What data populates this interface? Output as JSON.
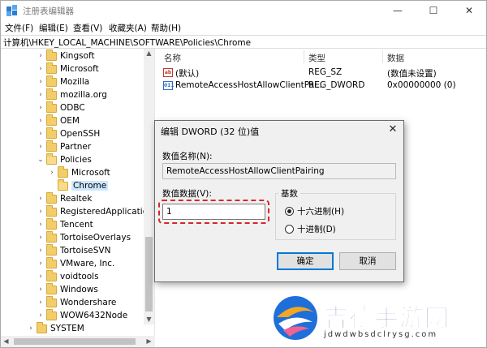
{
  "window": {
    "title": "注册表编辑器",
    "minimize": "—",
    "maximize": "☐",
    "close": "✕"
  },
  "menu": [
    "文件(F)",
    "编辑(E)",
    "查看(V)",
    "收藏夹(A)",
    "帮助(H)"
  ],
  "address": "计算机\\HKEY_LOCAL_MACHINE\\SOFTWARE\\Policies\\Chrome",
  "tree": [
    {
      "label": "Kingsoft",
      "chevron": "›"
    },
    {
      "label": "Microsoft",
      "chevron": "›"
    },
    {
      "label": "Mozilla",
      "chevron": "›"
    },
    {
      "label": "mozilla.org",
      "chevron": "›"
    },
    {
      "label": "ODBC",
      "chevron": "›"
    },
    {
      "label": "OEM",
      "chevron": "›"
    },
    {
      "label": "OpenSSH",
      "chevron": "›"
    },
    {
      "label": "Partner",
      "chevron": "›"
    },
    {
      "label": "Policies",
      "chevron": "⌄"
    },
    {
      "label": "Microsoft",
      "chevron": "›"
    },
    {
      "label": "Chrome",
      "chevron": ""
    },
    {
      "label": "Realtek",
      "chevron": "›"
    },
    {
      "label": "RegisteredApplication",
      "chevron": "›"
    },
    {
      "label": "Tencent",
      "chevron": "›"
    },
    {
      "label": "TortoiseOverlays",
      "chevron": "›"
    },
    {
      "label": "TortoiseSVN",
      "chevron": "›"
    },
    {
      "label": "VMware, Inc.",
      "chevron": "›"
    },
    {
      "label": "voidtools",
      "chevron": "›"
    },
    {
      "label": "Windows",
      "chevron": "›"
    },
    {
      "label": "Wondershare",
      "chevron": "›"
    },
    {
      "label": "WOW6432Node",
      "chevron": "›"
    },
    {
      "label": "SYSTEM",
      "chevron": "›"
    }
  ],
  "list": {
    "headers": {
      "name": "名称",
      "type": "类型",
      "data": "数据"
    },
    "rows": [
      {
        "icon": "ab",
        "name": "(默认)",
        "type": "REG_SZ",
        "data": "(数值未设置)"
      },
      {
        "icon": "011",
        "name": "RemoteAccessHostAllowClientPai...",
        "type": "REG_DWORD",
        "data": "0x00000000 (0)"
      }
    ]
  },
  "dialog": {
    "title": "编辑 DWORD (32 位)值",
    "close": "✕",
    "name_label": "数值名称(N):",
    "name_value": "RemoteAccessHostAllowClientPairing",
    "data_label": "数值数据(V):",
    "data_value": "1",
    "base_label": "基数",
    "hex_label": "十六进制(H)",
    "dec_label": "十进制(D)",
    "selected_base": "hex",
    "ok": "确定",
    "cancel": "取消"
  },
  "watermark": {
    "text": "吉德手游网",
    "url": "jdwdwbsdclrysg.com"
  }
}
